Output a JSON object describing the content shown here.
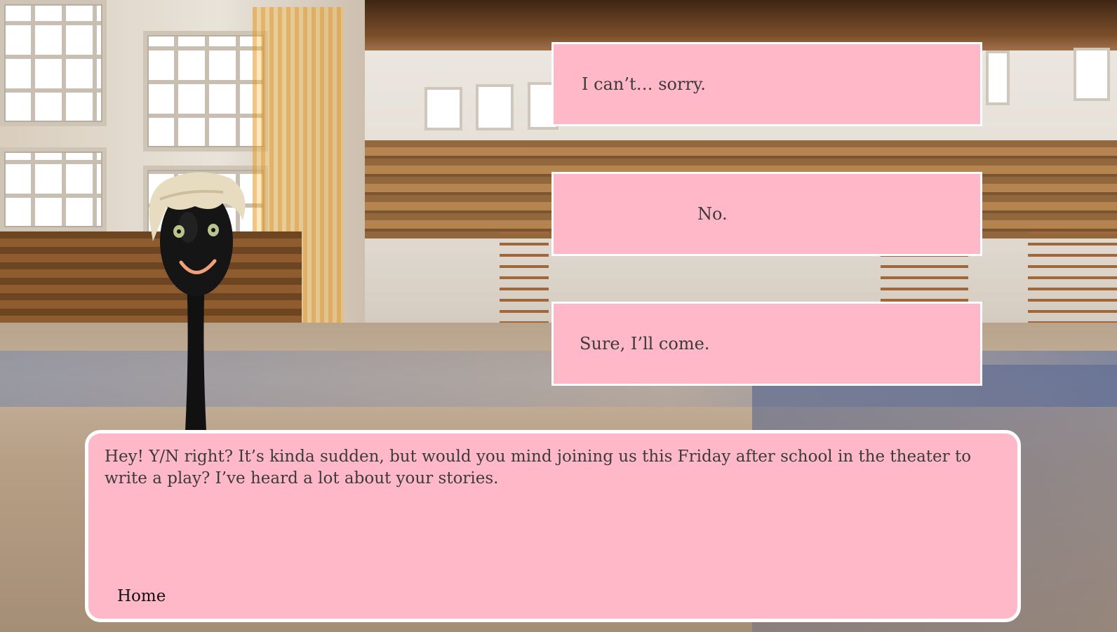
{
  "choices": [
    {
      "label": "I can’t… sorry."
    },
    {
      "label": "No."
    },
    {
      "label": "Sure, I’ll come."
    }
  ],
  "dialogue": {
    "text": "Hey! Y/N right? It’s kinda sudden, but would you mind joining us this Friday after school in the theater to write a play? I’ve heard a lot about your stories."
  },
  "nav": {
    "home_label": "Home"
  },
  "colors": {
    "box_fill": "#ffb8c8",
    "box_border": "#ffffff",
    "text": "#3b3b3b"
  },
  "icons": {
    "character": "spoon-character-sprite"
  }
}
